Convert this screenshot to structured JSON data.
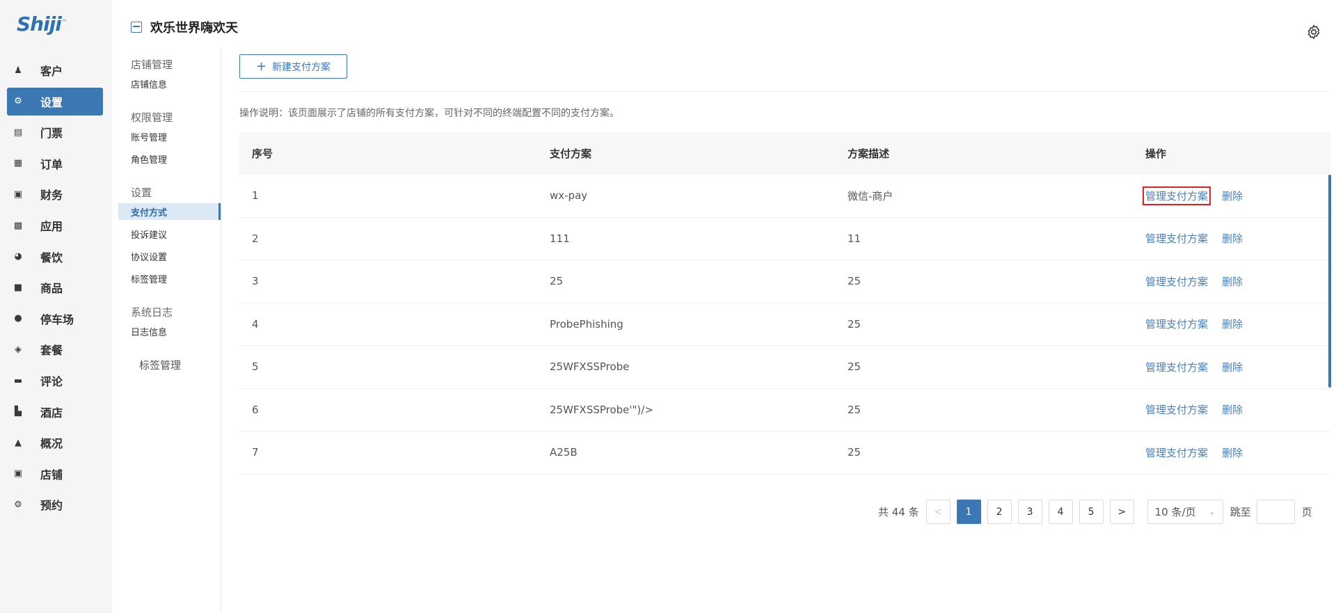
{
  "logo": {
    "text": "Shiji",
    "mark": "™"
  },
  "nav": [
    {
      "icon": "user-icon",
      "label": "客户"
    },
    {
      "icon": "gear-icon",
      "label": "设置",
      "active": true
    },
    {
      "icon": "ticket-icon",
      "label": "门票"
    },
    {
      "icon": "order-icon",
      "label": "订单"
    },
    {
      "icon": "finance-icon",
      "label": "财务"
    },
    {
      "icon": "apps-icon",
      "label": "应用"
    },
    {
      "icon": "dining-icon",
      "label": "餐饮"
    },
    {
      "icon": "shopping-bag-icon",
      "label": "商品"
    },
    {
      "icon": "parking-icon",
      "label": "停车场"
    },
    {
      "icon": "layers-icon",
      "label": "套餐"
    },
    {
      "icon": "comment-icon",
      "label": "评论"
    },
    {
      "icon": "hotel-icon",
      "label": "酒店"
    },
    {
      "icon": "chart-icon",
      "label": "概况"
    },
    {
      "icon": "store-icon",
      "label": "店铺"
    },
    {
      "icon": "gear-icon",
      "label": "预约"
    }
  ],
  "header": {
    "title": "欢乐世界嗨欢天"
  },
  "submenu": {
    "groups": [
      {
        "title": "店铺管理",
        "items": [
          "店铺信息"
        ]
      },
      {
        "title": "权限管理",
        "items": [
          "账号管理",
          "角色管理"
        ]
      },
      {
        "title": "设置",
        "items": [
          "支付方式",
          "投诉建议",
          "协议设置",
          "标签管理"
        ]
      },
      {
        "title": "系统日志",
        "items": [
          "日志信息"
        ]
      }
    ],
    "extra": "标签管理"
  },
  "main": {
    "new_button": "新建支付方案",
    "note": "操作说明：该页面展示了店铺的所有支付方案，可针对不同的终端配置不同的支付方案。",
    "columns": [
      "序号",
      "支付方案",
      "方案描述",
      "操作"
    ],
    "rows": [
      {
        "no": "1",
        "name": "wx-pay",
        "desc": "微信-商户"
      },
      {
        "no": "2",
        "name": "111",
        "desc": "11"
      },
      {
        "no": "3",
        "name": "25",
        "desc": "25"
      },
      {
        "no": "4",
        "name": "ProbePhishing",
        "desc": "25"
      },
      {
        "no": "5",
        "name": "25WFXSSProbe",
        "desc": "25"
      },
      {
        "no": "6",
        "name": "25WFXSSProbe'\")/>",
        "desc": "25"
      },
      {
        "no": "7",
        "name": "A25B",
        "desc": "25"
      }
    ],
    "manage_label": "管理支付方案",
    "delete_label": "删除"
  },
  "pagination": {
    "total": "共 44 条",
    "prev": "<",
    "pages": [
      "1",
      "2",
      "3",
      "4",
      "5"
    ],
    "current": "1",
    "next": ">",
    "page_size": "10 条/页",
    "jump_label": "跳至",
    "page_suffix": "页"
  }
}
